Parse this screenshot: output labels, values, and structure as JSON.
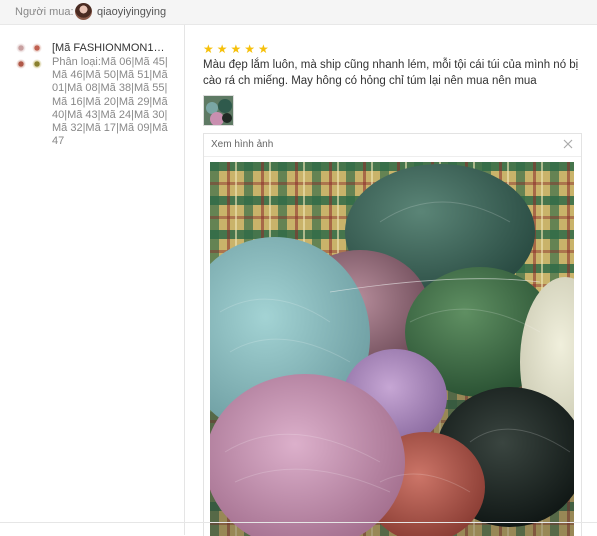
{
  "buyer": {
    "label": "Người mua:",
    "username": "qiaoyiyingying",
    "avatar_icon": "user-avatar-icon"
  },
  "product": {
    "name": "[Mã FASHIONMON19…",
    "variant": "Phân loại:Mã 06|Mã 45|Mã 46|Mã 50|Mã 51|Mã 01|Mã 08|Mã 38|Mã 55|Mã 16|Mã 20|Mã 29|Mã 40|Mã 43|Mã 24|Mã 30|Mã 32|Mã 17|Mã 09|Mã 47"
  },
  "review": {
    "rating": 5,
    "stars": "★★★★★",
    "star_color": "#f6c00a",
    "text": "Màu đẹp lắm luôn, mà ship cũng nhanh lém, mỗi tội cái túi của mình nó bị cào rá ch miếng. May hông có hỏng chỉ túm lại nên mua nên mua"
  },
  "image_viewer": {
    "title": "Xem hình ảnh",
    "close_icon": "close-icon",
    "image_description_icon": "yarn-photo"
  }
}
